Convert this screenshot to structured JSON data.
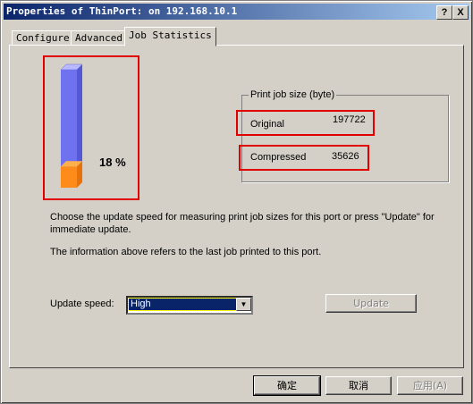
{
  "window": {
    "title": "Properties of ThinPort: on 192.168.10.1",
    "help_label": "?",
    "close_label": "X"
  },
  "tabs": [
    {
      "label": "Configure"
    },
    {
      "label": "Advanced"
    },
    {
      "label": "Job Statistics",
      "active": true
    }
  ],
  "gauge": {
    "percent_label": "18 %",
    "fill_fraction": 0.18,
    "colors": {
      "empty": "#6f72f0",
      "fill": "#ff8c1a"
    }
  },
  "print_job_size": {
    "group_label": "Print job size (byte)",
    "original": {
      "label": "Original",
      "value": "197722"
    },
    "compressed": {
      "label": "Compressed",
      "value": "35626"
    }
  },
  "info": {
    "line1": "Choose the update speed for measuring print job sizes for this port or press \"Update\" for",
    "line2": "immediate update.",
    "line3": "The information above refers to the last job printed to this port."
  },
  "update_speed": {
    "label": "Update speed:",
    "selected": "High"
  },
  "update_button": "Update",
  "dialog_buttons": {
    "ok": "确定",
    "cancel": "取消",
    "apply": "应用(A)"
  },
  "colors": {
    "titlebar_start": "#0a246a",
    "titlebar_end": "#a6caf0",
    "highlight_box": "#e00000"
  }
}
